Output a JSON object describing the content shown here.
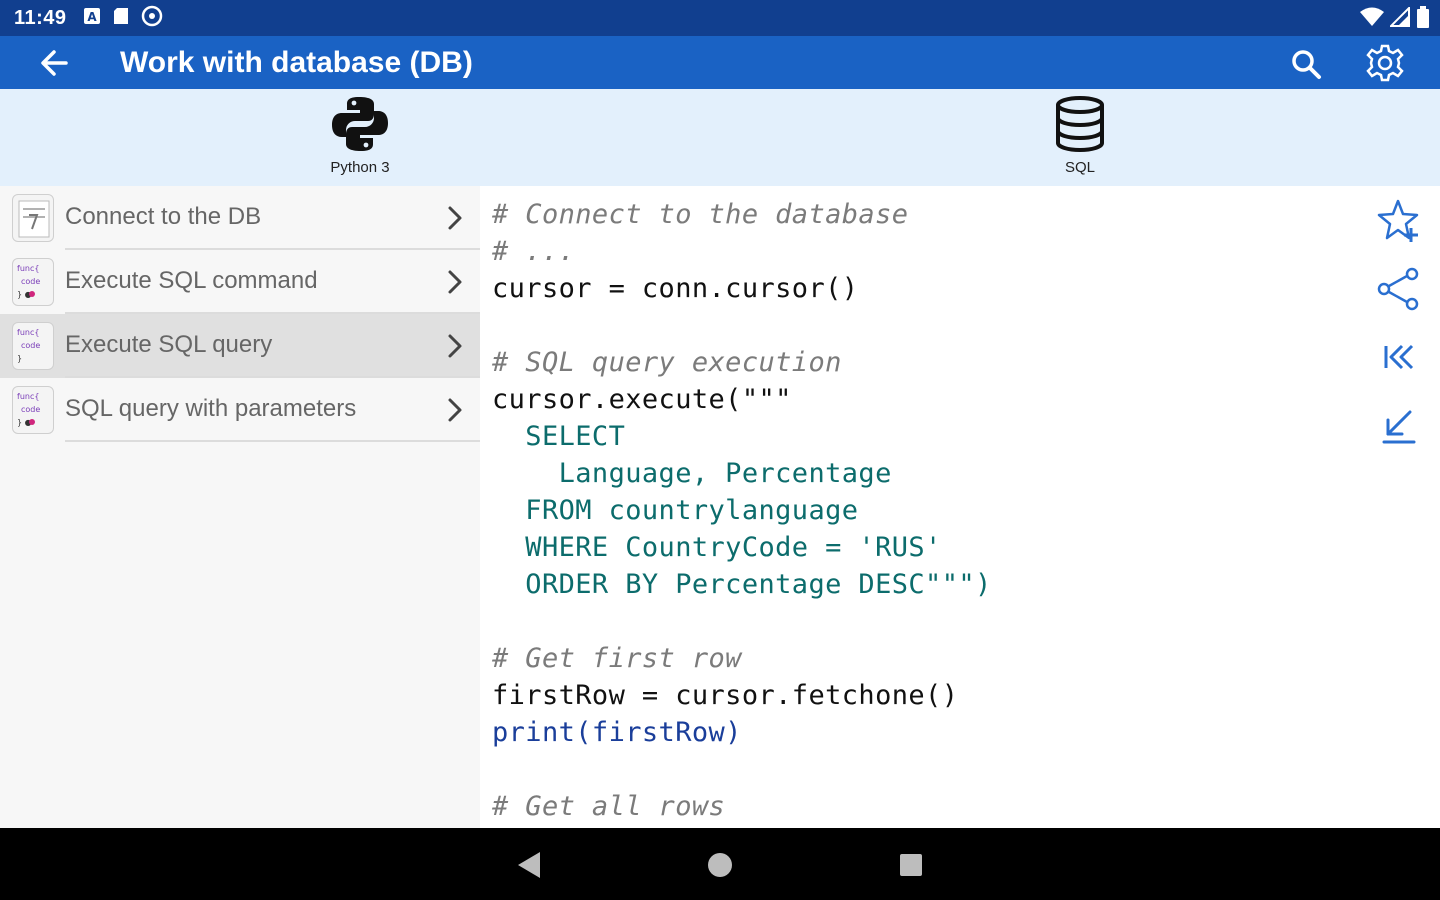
{
  "statusbar": {
    "time": "11:49"
  },
  "appbar": {
    "title": "Work with database (DB)"
  },
  "tabs": [
    {
      "label": "Python 3",
      "icon": "python-logo-icon"
    },
    {
      "label": "SQL",
      "icon": "database-icon"
    }
  ],
  "list": {
    "items": [
      {
        "label": "Connect to the DB",
        "icon": "notepad-icon",
        "selected": false
      },
      {
        "label": "Execute SQL command",
        "icon": "func-code-icon",
        "selected": false
      },
      {
        "label": "Execute SQL query",
        "icon": "func-code-icon",
        "selected": true
      },
      {
        "label": "SQL query with parameters",
        "icon": "func-code-icon",
        "selected": false
      }
    ]
  },
  "code": {
    "lines": [
      "# Connect to the database",
      "# ...",
      "cursor = conn.cursor()",
      "",
      "# SQL query execution",
      "cursor.execute(\"\"\"",
      "  SELECT",
      "    Language, Percentage",
      "  FROM countrylanguage",
      "  WHERE CountryCode = 'RUS'",
      "  ORDER BY Percentage DESC\"\"\")",
      "",
      "# Get first row",
      "firstRow = cursor.fetchone()",
      "print(firstRow)",
      "",
      "# Get all rows"
    ]
  },
  "colors": {
    "statusbar": "#113f8f",
    "appbar": "#1a62c4",
    "tabs_bg": "#e3f0fc",
    "accent": "#2a6fd0"
  }
}
